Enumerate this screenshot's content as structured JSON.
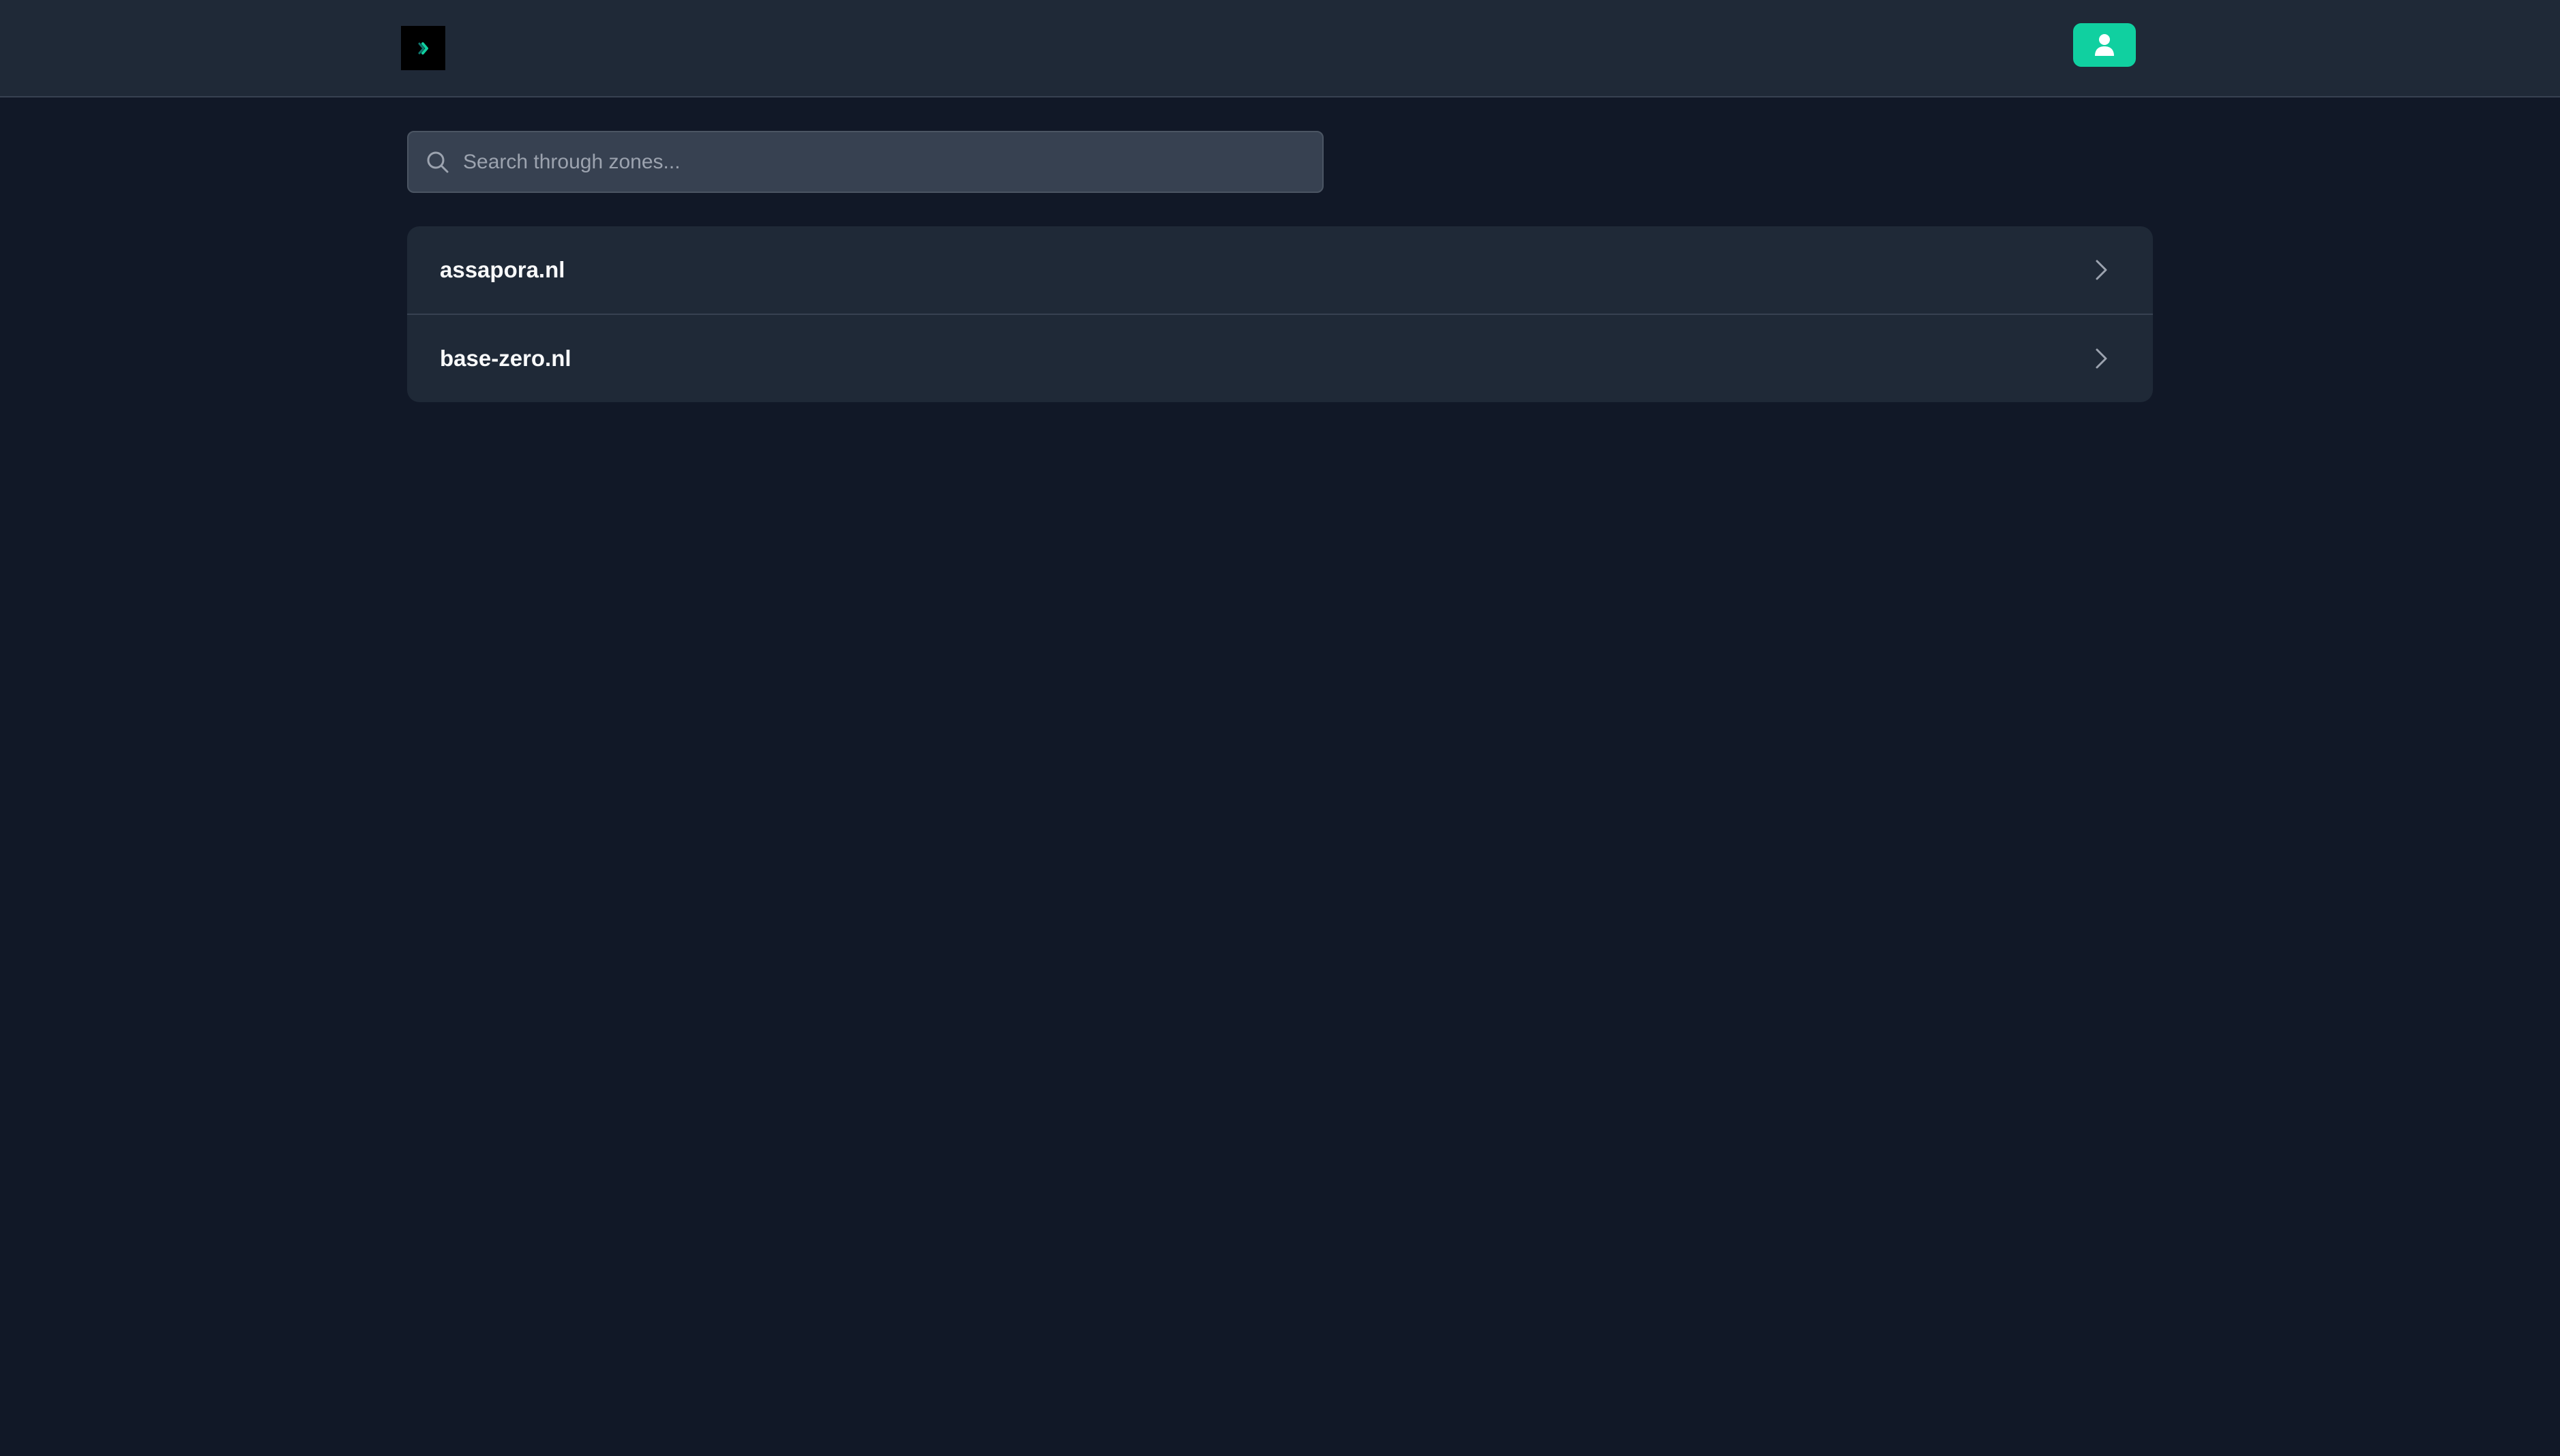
{
  "header": {
    "logo_icon": "chevron-right-logo-icon",
    "user_button_icon": "user-icon",
    "accent_color": "#10d0a0"
  },
  "search": {
    "placeholder": "Search through zones...",
    "value": "",
    "icon": "search-icon"
  },
  "zones": [
    {
      "name": "assapora.nl",
      "icon": "chevron-right-icon"
    },
    {
      "name": "base-zero.nl",
      "icon": "chevron-right-icon"
    }
  ]
}
